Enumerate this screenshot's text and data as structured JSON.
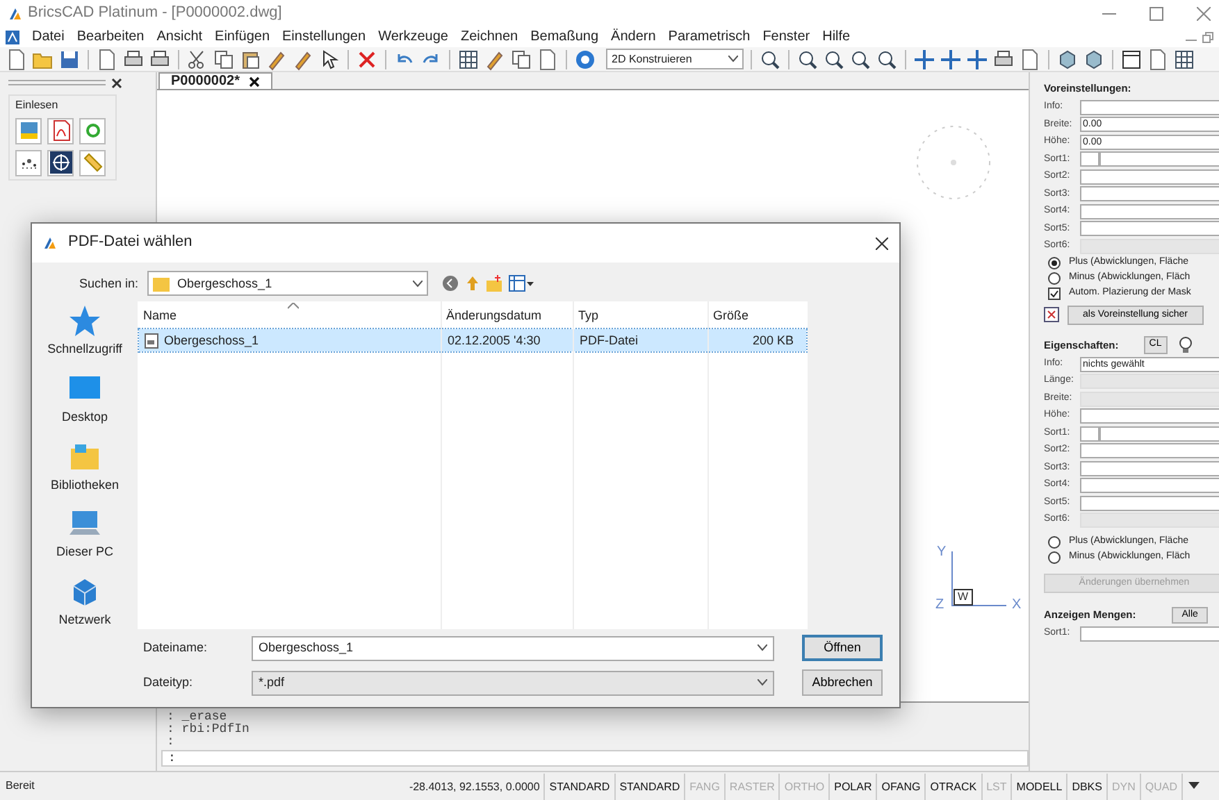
{
  "window": {
    "title": "BricsCAD Platinum - [P0000002.dwg]"
  },
  "menu": [
    "Datei",
    "Bearbeiten",
    "Ansicht",
    "Einfügen",
    "Einstellungen",
    "Werkzeuge",
    "Zeichnen",
    "Bemaßung",
    "Ändern",
    "Parametrisch",
    "Fenster",
    "Hilfe"
  ],
  "toolbar": {
    "workspace": "2D Konstruieren"
  },
  "left_panel": {
    "group": "Einlesen"
  },
  "document_tab": {
    "label": "P0000002*"
  },
  "ucs_icon": {
    "y": "Y",
    "x": "X",
    "z": "Z",
    "w": "W"
  },
  "command_line": {
    "history": [
      ": _erase",
      ": rbi:PdfIn",
      ":"
    ],
    "prompt": ":"
  },
  "right_panel": {
    "presets": {
      "title": "Voreinstellungen:",
      "fields": [
        {
          "label": "Info:",
          "kind": "text",
          "disabled": false
        },
        {
          "label": "Breite:",
          "kind": "text",
          "value": "0.00",
          "disabled": false
        },
        {
          "label": "Höhe:",
          "kind": "text",
          "value": "0.00",
          "disabled": false
        },
        {
          "label": "Sort1:",
          "kind": "split",
          "disabled": false
        },
        {
          "label": "Sort2:",
          "kind": "combo",
          "disabled": false
        },
        {
          "label": "Sort3:",
          "kind": "combo",
          "disabled": false
        },
        {
          "label": "Sort4:",
          "kind": "combo",
          "disabled": false
        },
        {
          "label": "Sort5:",
          "kind": "combo",
          "disabled": false
        },
        {
          "label": "Sort6:",
          "kind": "combo",
          "disabled": true
        }
      ],
      "options": [
        {
          "kind": "radio",
          "label": "Plus (Abwicklungen, Fläche",
          "selected": true
        },
        {
          "kind": "radio",
          "label": "Minus (Abwicklungen, Fläch",
          "selected": false
        },
        {
          "kind": "checkbox",
          "label": "Autom. Plazierung der Mask",
          "checked": true
        }
      ],
      "button": {
        "label": "als Voreinstellung sicher",
        "disabled": false
      }
    },
    "properties": {
      "title": "Eigenschaften:",
      "tool": "CL",
      "fields": [
        {
          "label": "Info:",
          "kind": "text",
          "value": "nichts gewählt",
          "disabled": false
        },
        {
          "label": "Länge:",
          "kind": "text",
          "disabled": true
        },
        {
          "label": "Breite:",
          "kind": "text",
          "disabled": true
        },
        {
          "label": "Höhe:",
          "kind": "text",
          "disabled": false
        },
        {
          "label": "Sort1:",
          "kind": "split",
          "disabled": false
        },
        {
          "label": "Sort2:",
          "kind": "combo",
          "disabled": false
        },
        {
          "label": "Sort3:",
          "kind": "combo",
          "disabled": false
        },
        {
          "label": "Sort4:",
          "kind": "combo",
          "disabled": false
        },
        {
          "label": "Sort5:",
          "kind": "combo",
          "disabled": false
        },
        {
          "label": "Sort6:",
          "kind": "combo",
          "disabled": true
        }
      ],
      "options": [
        {
          "kind": "radio",
          "label": "Plus (Abwicklungen, Fläche",
          "selected": false
        },
        {
          "kind": "radio",
          "label": "Minus (Abwicklungen, Fläch",
          "selected": false
        }
      ],
      "button": {
        "label": "Änderungen übernehmen",
        "disabled": true
      }
    },
    "quantities": {
      "title": "Anzeigen Mengen:",
      "button": "Alle",
      "fields": [
        {
          "label": "Sort1:",
          "kind": "combo",
          "disabled": false
        }
      ]
    }
  },
  "dialog": {
    "title": "PDF-Datei wählen",
    "look_in": {
      "label": "Suchen in:",
      "value": "Obergeschoss_1"
    },
    "places": [
      "Schnellzugriff",
      "Desktop",
      "Bibliotheken",
      "Dieser PC",
      "Netzwerk"
    ],
    "columns": [
      "Name",
      "Änderungsdatum",
      "Typ",
      "Größe"
    ],
    "rows": [
      {
        "name": "Obergeschoss_1",
        "date": "02.12.2005 '4:30",
        "type": "PDF-Datei",
        "size": "200 KB",
        "selected": true
      }
    ],
    "file_name": {
      "label": "Dateiname:",
      "value": "Obergeschoss_1"
    },
    "file_type": {
      "label": "Dateityp:",
      "value": "*.pdf"
    },
    "buttons": [
      "Öffnen",
      "Abbrechen"
    ]
  },
  "status_bar": {
    "message": "Bereit",
    "coordinates": "-28.4013, 92.1553, 0.0000",
    "toggles": [
      {
        "label": "STANDARD",
        "on": true
      },
      {
        "label": "STANDARD",
        "on": true
      },
      {
        "label": "FANG",
        "on": false
      },
      {
        "label": "RASTER",
        "on": false
      },
      {
        "label": "ORTHO",
        "on": false
      },
      {
        "label": "POLAR",
        "on": true
      },
      {
        "label": "OFANG",
        "on": true
      },
      {
        "label": "OTRACK",
        "on": true
      },
      {
        "label": "LST",
        "on": false
      },
      {
        "label": "MODELL",
        "on": true
      },
      {
        "label": "DBKS",
        "on": true
      },
      {
        "label": "DYN",
        "on": false
      },
      {
        "label": "QUAD",
        "on": false
      }
    ]
  }
}
